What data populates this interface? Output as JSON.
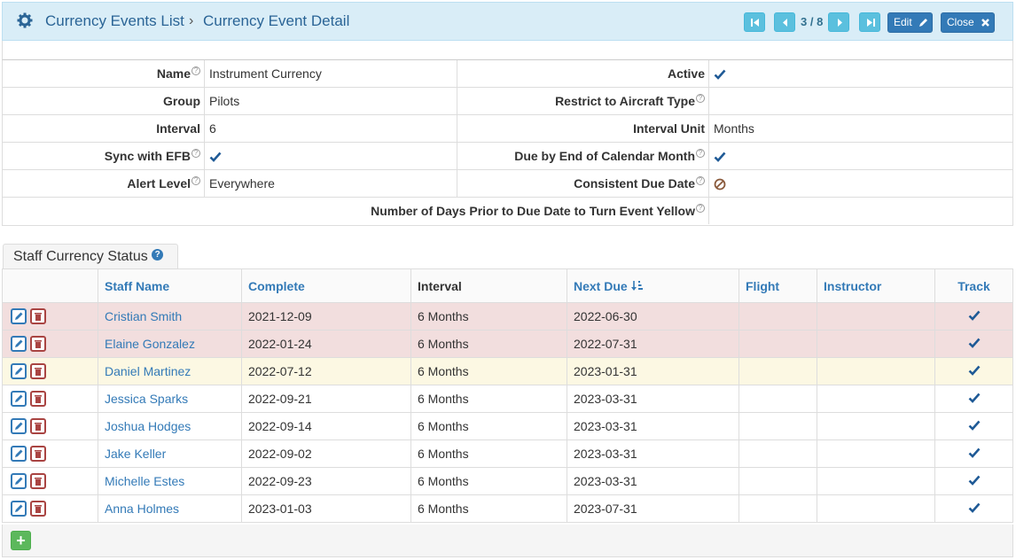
{
  "header": {
    "breadcrumb_parent": "Currency Events List",
    "breadcrumb_separator": "›",
    "breadcrumb_current": "Currency Event Detail",
    "record_counter": "3 / 8",
    "edit_label": "Edit",
    "close_label": "Close"
  },
  "detail": {
    "name_label": "Name",
    "name_value": "Instrument Currency",
    "active_label": "Active",
    "group_label": "Group",
    "group_value": "Pilots",
    "restrict_label": "Restrict to Aircraft Type",
    "restrict_value": "",
    "interval_label": "Interval",
    "interval_value": "6",
    "interval_unit_label": "Interval Unit",
    "interval_unit_value": "Months",
    "sync_label": "Sync with EFB",
    "due_end_label": "Due by End of Calendar Month",
    "alert_label": "Alert Level",
    "alert_value": "Everywhere",
    "consistent_label": "Consistent Due Date",
    "days_prior_label": "Number of Days Prior to Due Date to Turn Event Yellow",
    "days_prior_value": ""
  },
  "tab": {
    "label": "Staff Currency Status",
    "help_glyph": "?"
  },
  "table": {
    "headers": {
      "staff_name": "Staff Name",
      "complete": "Complete",
      "interval": "Interval",
      "next_due": "Next Due",
      "flight": "Flight",
      "instructor": "Instructor",
      "track": "Track"
    },
    "rows": [
      {
        "name": "Cristian Smith",
        "complete": "2021-12-09",
        "interval": "6 Months",
        "next_due": "2022-06-30",
        "status": "red"
      },
      {
        "name": "Elaine Gonzalez",
        "complete": "2022-01-24",
        "interval": "6 Months",
        "next_due": "2022-07-31",
        "status": "red"
      },
      {
        "name": "Daniel Martinez",
        "complete": "2022-07-12",
        "interval": "6 Months",
        "next_due": "2023-01-31",
        "status": "yellow"
      },
      {
        "name": "Jessica Sparks",
        "complete": "2022-09-21",
        "interval": "6 Months",
        "next_due": "2023-03-31",
        "status": "normal"
      },
      {
        "name": "Joshua Hodges",
        "complete": "2022-09-14",
        "interval": "6 Months",
        "next_due": "2023-03-31",
        "status": "normal"
      },
      {
        "name": "Jake Keller",
        "complete": "2022-09-02",
        "interval": "6 Months",
        "next_due": "2023-03-31",
        "status": "normal"
      },
      {
        "name": "Michelle Estes",
        "complete": "2022-09-23",
        "interval": "6 Months",
        "next_due": "2023-03-31",
        "status": "normal"
      },
      {
        "name": "Anna Holmes",
        "complete": "2023-01-03",
        "interval": "6 Months",
        "next_due": "2023-07-31",
        "status": "normal"
      }
    ]
  },
  "footer": {
    "add_glyph": "+"
  },
  "colors": {
    "header_bg": "#d9edf7",
    "link": "#337ab7",
    "nav_button": "#5bc0de",
    "row_overdue": "#f2dede",
    "row_warning": "#fcf8e3",
    "add_button": "#5cb85c",
    "delete_icon": "#a94442",
    "check": "#1f5a96",
    "forbidden": "#8a5a3c"
  }
}
